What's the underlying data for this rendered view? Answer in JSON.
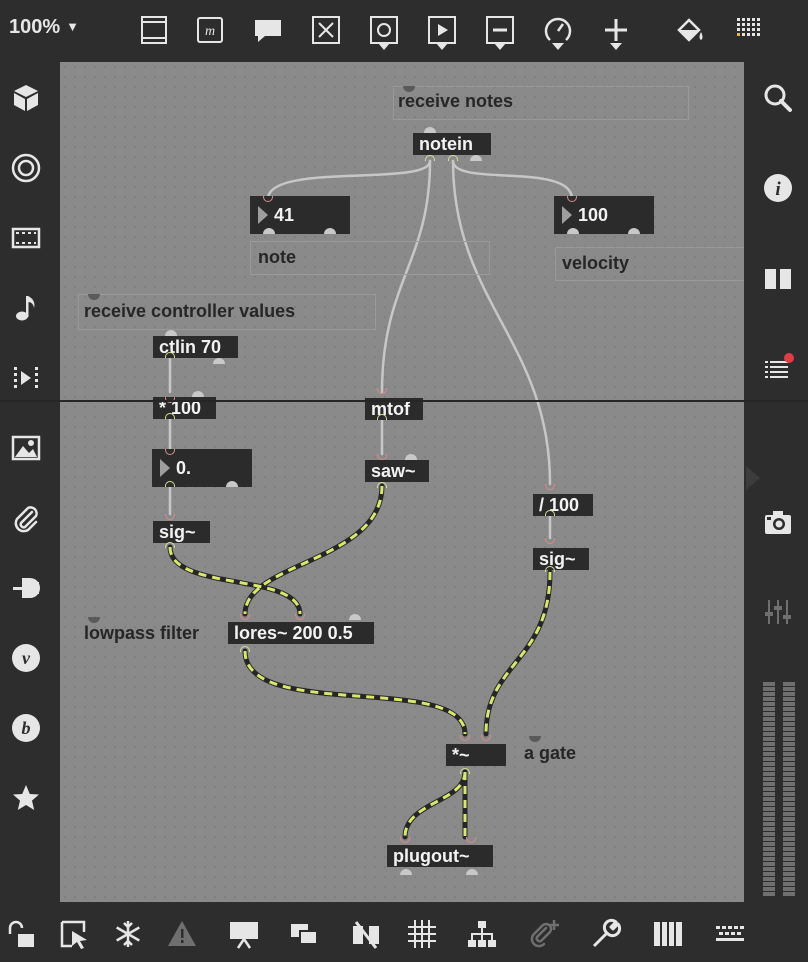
{
  "toolbar": {
    "zoom": "100%",
    "icons": [
      "presentation-icon",
      "message-box-icon",
      "comment-icon",
      "toggle-icon",
      "button-icon",
      "play-icon",
      "slider-icon",
      "dial-icon",
      "plus-icon",
      "paint-bucket-icon",
      "grid-icon"
    ]
  },
  "left_sidebar": {
    "icons": [
      "cube-icon",
      "target-icon",
      "video-icon",
      "music-note-icon",
      "media-icon",
      "image-icon",
      "paperclip-icon",
      "plug-icon",
      "v-icon",
      "b-icon",
      "star-icon"
    ]
  },
  "right_sidebar": {
    "icons": [
      "search-icon",
      "info-icon",
      "book-icon",
      "list-icon",
      "camera-icon",
      "mixer-icon"
    ],
    "notification_color": "#e53b45"
  },
  "bottom_bar": {
    "icons": [
      "lock-icon",
      "select-icon",
      "freeze-icon",
      "warning-icon",
      "presentation-mode-icon",
      "windows-icon",
      "hide-icon",
      "grid-snap-icon",
      "hierarchy-icon",
      "attach-icon",
      "wrench-icon",
      "piano-icon",
      "keyboard-icon"
    ]
  },
  "patch": {
    "comments": {
      "receive_notes": "receive notes",
      "note": "note",
      "velocity": "velocity",
      "receive_controller": "receive controller values",
      "lowpass": "lowpass filter",
      "gate": "a gate"
    },
    "objects": {
      "notein": "notein",
      "ctlin": "ctlin 70",
      "mult100": "* 100",
      "mtof": "mtof",
      "saw": "saw~",
      "div100": "/ 100",
      "sig1": "sig~",
      "sig2": "sig~",
      "lores": "lores~ 200 0.5",
      "times": "*~",
      "plugout": "plugout~"
    },
    "numbers": {
      "note": "41",
      "velocity": "100",
      "float": "0."
    }
  }
}
